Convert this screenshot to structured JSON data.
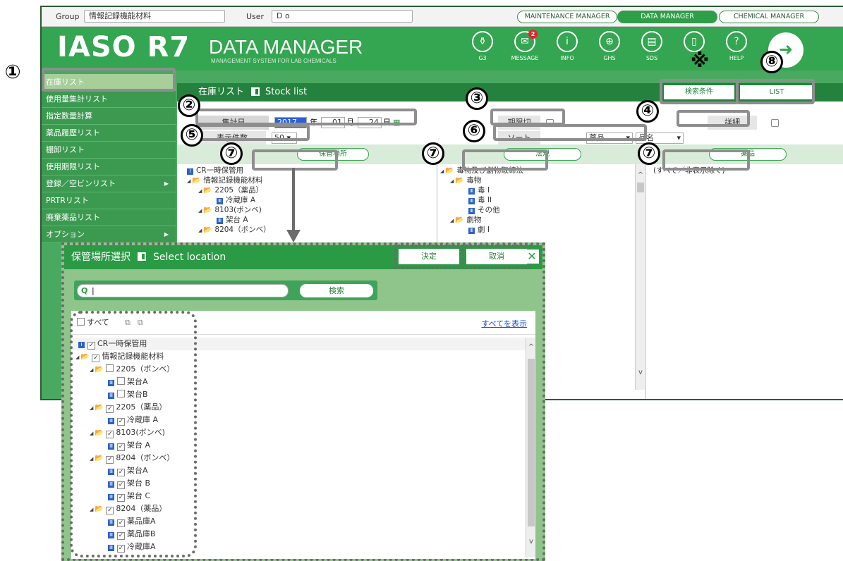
{
  "topbar": {
    "group_label": "Group",
    "group_value": "情報記録機能材料",
    "user_label": "User",
    "user_value": "D o",
    "tabs": [
      "MAINTENANCE MANAGER",
      "DATA MANAGER",
      "CHEMICAL MANAGER"
    ]
  },
  "header": {
    "logo": "IASO R7",
    "title": "DATA MANAGER",
    "subtitle": "MANAGEMENT SYSTEM FOR LAB CHEMICALS",
    "icons": [
      {
        "label": "G3",
        "icon": "bottle-icon"
      },
      {
        "label": "MESSAGE",
        "icon": "mail-icon",
        "badge": "2"
      },
      {
        "label": "INFO",
        "icon": "info-icon"
      },
      {
        "label": "GHS",
        "icon": "globe-icon"
      },
      {
        "label": "SDS",
        "icon": "document-icon"
      },
      {
        "label": "",
        "icon": "phone-icon"
      },
      {
        "label": "HELP",
        "icon": "help-icon"
      }
    ]
  },
  "sidebar": {
    "items": [
      {
        "label": "在庫リスト"
      },
      {
        "label": "使用量集計リスト"
      },
      {
        "label": "指定数量計算"
      },
      {
        "label": "薬品履歴リスト"
      },
      {
        "label": "棚卸リスト"
      },
      {
        "label": "使用期限リスト"
      },
      {
        "label": "登録／空ビンリスト"
      },
      {
        "label": "PRTRリスト"
      },
      {
        "label": "廃棄薬品リスト"
      },
      {
        "label": "オプション"
      }
    ]
  },
  "main": {
    "title_jp": "在庫リスト",
    "title_en": "Stock list",
    "btn_search_cond": "検索条件",
    "btn_list": "LIST",
    "date_label": "集計日",
    "year": "2017",
    "year_unit": "年",
    "month": "01",
    "month_unit": "月",
    "day": "24",
    "day_unit": "日",
    "expired_label": "期限切",
    "detail_label": "詳細",
    "count_label": "表示件数",
    "count_value": "50",
    "sort_label": "ソート",
    "sort_value1": "薬品",
    "sort_value2": "品名",
    "col_location": "保管場所",
    "col_law": "法規",
    "col_chemical": "薬品",
    "chem_note": "(すべて／非表示除く)",
    "loc_tree": [
      "CR一時保管用",
      "情報記録機能材料",
      "2205（薬品）",
      "冷蔵庫 A",
      "8103(ボンベ)",
      "架台 A",
      "8204（ボンベ）"
    ],
    "law_tree": [
      "毒物及び劇物取締法",
      "毒物",
      "毒 I",
      "毒 II",
      "その他",
      "劇物",
      "劇 I"
    ]
  },
  "dialog": {
    "title_jp": "保管場所選択",
    "title_en": "Select location",
    "confirm": "決定",
    "cancel": "取消",
    "close": "✕",
    "search_placeholder": "",
    "search_btn": "検索",
    "all_label": "すべて",
    "show_all": "すべてを表示",
    "tree": [
      {
        "label": "CR一時保管用",
        "checked": true
      },
      {
        "label": "情報記録機能材料",
        "checked": true
      },
      {
        "label": "2205（ボンベ）",
        "checked": false
      },
      {
        "label": "架台A",
        "checked": false
      },
      {
        "label": "架台B",
        "checked": false
      },
      {
        "label": "2205（薬品）",
        "checked": true
      },
      {
        "label": "冷蔵庫 A",
        "checked": true
      },
      {
        "label": "8103(ボンベ)",
        "checked": true
      },
      {
        "label": "架台 A",
        "checked": true
      },
      {
        "label": "8204（ボンベ）",
        "checked": true
      },
      {
        "label": "架台A",
        "checked": true
      },
      {
        "label": "架台 B",
        "checked": true
      },
      {
        "label": "架台 C",
        "checked": true
      },
      {
        "label": "8204（薬品）",
        "checked": true
      },
      {
        "label": "薬品庫A",
        "checked": true
      },
      {
        "label": "薬品庫B",
        "checked": true
      },
      {
        "label": "冷蔵庫A",
        "checked": true
      }
    ]
  },
  "annotations": {
    "n1": "①",
    "n2": "②",
    "n3": "③",
    "n4": "④",
    "n5": "⑤",
    "n6": "⑥",
    "n7": "⑦",
    "n8": "⑧",
    "kome": "※"
  },
  "colors": {
    "brand_green": "#34a550",
    "dark_green": "#24823e",
    "dialog_bg": "#8fc48a",
    "highlight_gray": "#8e8e8e"
  }
}
